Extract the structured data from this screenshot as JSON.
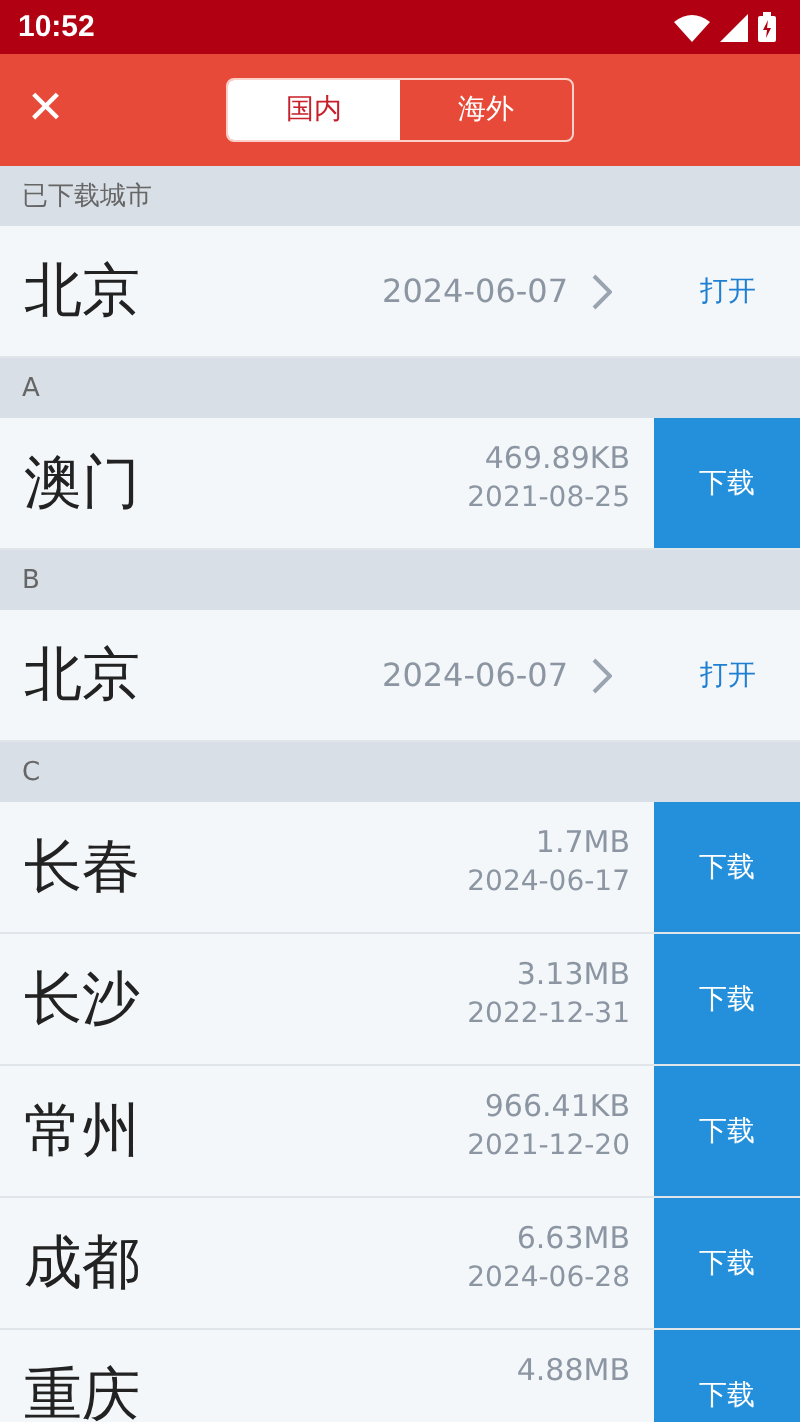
{
  "status_bar": {
    "time": "10:52"
  },
  "header": {
    "close": "×",
    "tabs": [
      {
        "label": "国内",
        "selected": true
      },
      {
        "label": "海外",
        "selected": false
      }
    ]
  },
  "sections": [
    {
      "title": "已下载城市",
      "rows": [
        {
          "kind": "downloaded",
          "city": "北京",
          "date": "2024-06-07",
          "action": "打开"
        }
      ]
    },
    {
      "title": "A",
      "rows": [
        {
          "kind": "available",
          "city": "澳门",
          "size": "469.89KB",
          "date": "2021-08-25",
          "action": "下载"
        }
      ]
    },
    {
      "title": "B",
      "rows": [
        {
          "kind": "downloaded",
          "city": "北京",
          "date": "2024-06-07",
          "action": "打开"
        }
      ]
    },
    {
      "title": "C",
      "rows": [
        {
          "kind": "available",
          "city": "长春",
          "size": "1.7MB",
          "date": "2024-06-17",
          "action": "下载"
        },
        {
          "kind": "available",
          "city": "长沙",
          "size": "3.13MB",
          "date": "2022-12-31",
          "action": "下载"
        },
        {
          "kind": "available",
          "city": "常州",
          "size": "966.41KB",
          "date": "2021-12-20",
          "action": "下载"
        },
        {
          "kind": "available",
          "city": "成都",
          "size": "6.63MB",
          "date": "2024-06-28",
          "action": "下载"
        },
        {
          "kind": "available",
          "city": "重庆",
          "size": "4.88MB",
          "action": "下载"
        }
      ]
    }
  ]
}
